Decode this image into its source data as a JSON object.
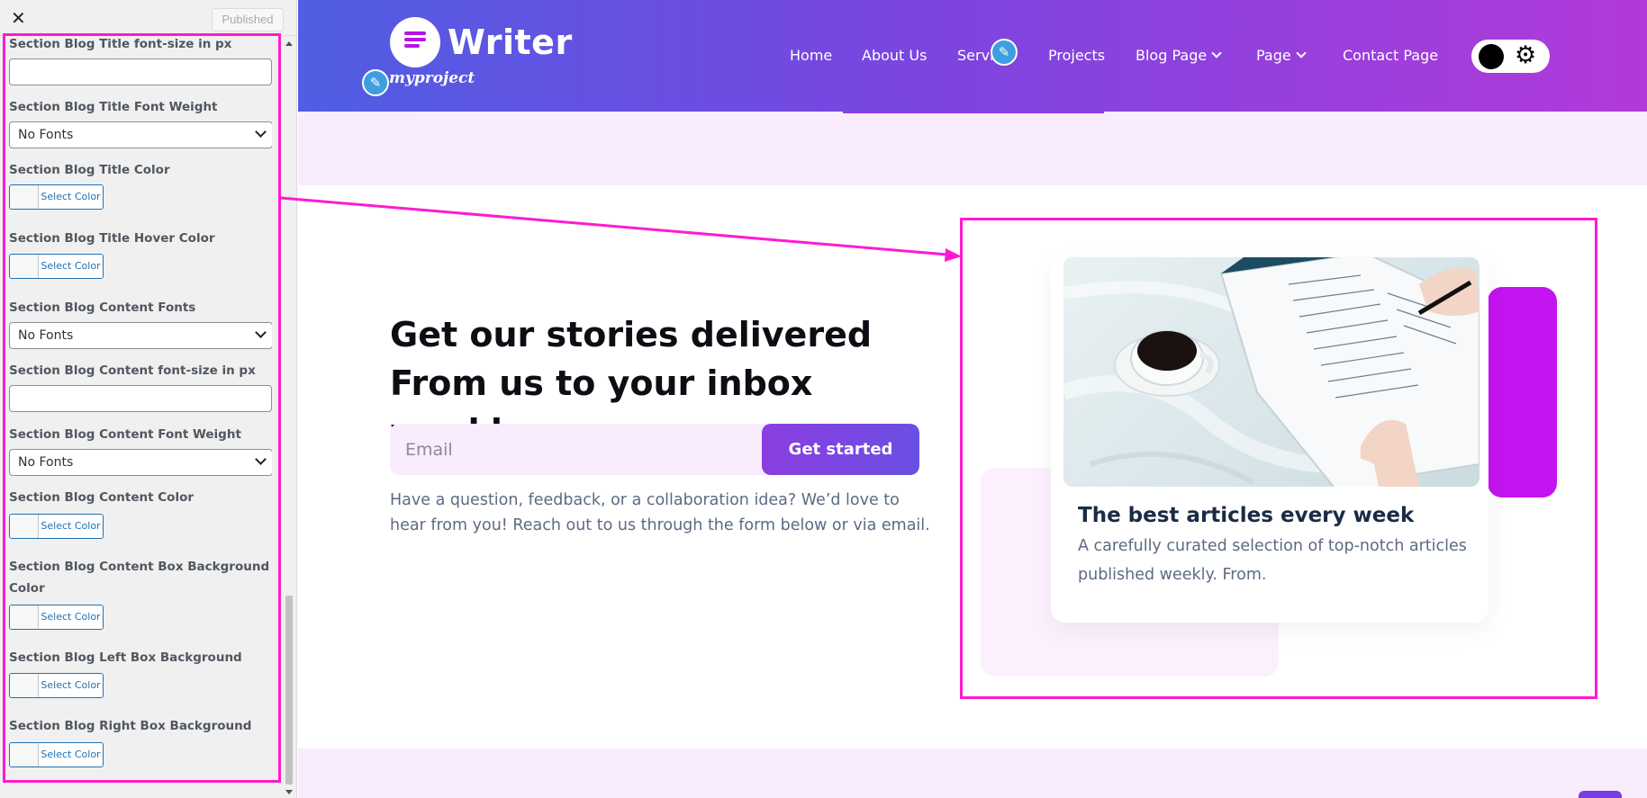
{
  "customizer": {
    "close_icon": "✕",
    "published_label": "Published",
    "fields": [
      {
        "label": "Section Blog Title font-size in px",
        "control": "text",
        "value": ""
      },
      {
        "label": "Section Blog Title Font Weight",
        "control": "select",
        "value": "No Fonts"
      },
      {
        "label": "Section Blog Title Color",
        "control": "color",
        "button": "Select Color"
      },
      {
        "label": "Section Blog Title Hover Color",
        "control": "color",
        "button": "Select Color"
      },
      {
        "label": "Section Blog Content Fonts",
        "control": "select",
        "value": "No Fonts"
      },
      {
        "label": "Section Blog Content font-size in px",
        "control": "text",
        "value": ""
      },
      {
        "label": "Section Blog Content Font Weight",
        "control": "select",
        "value": "No Fonts"
      },
      {
        "label": "Section Blog Content Color",
        "control": "color",
        "button": "Select Color"
      },
      {
        "label": "Section Blog Content Box Background",
        "label2": "Color",
        "control": "color",
        "button": "Select Color"
      },
      {
        "label": "Section Blog Left Box Background Color",
        "control": "color",
        "button": "Select Color"
      },
      {
        "label": "Section Blog Right Box Background Color",
        "control": "color",
        "button": "Select Color"
      }
    ]
  },
  "site": {
    "logo_text": "Writer",
    "tagline": "myproject",
    "edit_icon": "✎",
    "nav": [
      {
        "label": "Home",
        "dropdown": false
      },
      {
        "label": "About Us",
        "dropdown": false
      },
      {
        "label": "Servi",
        "dropdown": false
      },
      {
        "label": "Projects",
        "dropdown": false
      },
      {
        "label": "Blog Page",
        "dropdown": true
      },
      {
        "label": "Page",
        "dropdown": true
      },
      {
        "label": "Contact Page",
        "dropdown": false
      }
    ],
    "theme_toggle_icon": "⚙"
  },
  "hero": {
    "title_line1": "Get our stories delivered",
    "title_line2": "From us to your inbox weekly.",
    "email_placeholder": "Email",
    "button_label": "Get started",
    "description": "Have a question, feedback, or a collaboration idea? We’d love to hear from you! Reach out to us through the form below or via email."
  },
  "card": {
    "title": "The best articles every week",
    "text": "A carefully curated selection of top-notch articles published weekly. From."
  },
  "colors": {
    "accent": "#b514e6",
    "highlight": "#ff1ad1",
    "header_start": "#4f5ee3",
    "header_end": "#b13ad9",
    "right_box": "#c414ef",
    "left_box": "#fcf0fe"
  }
}
